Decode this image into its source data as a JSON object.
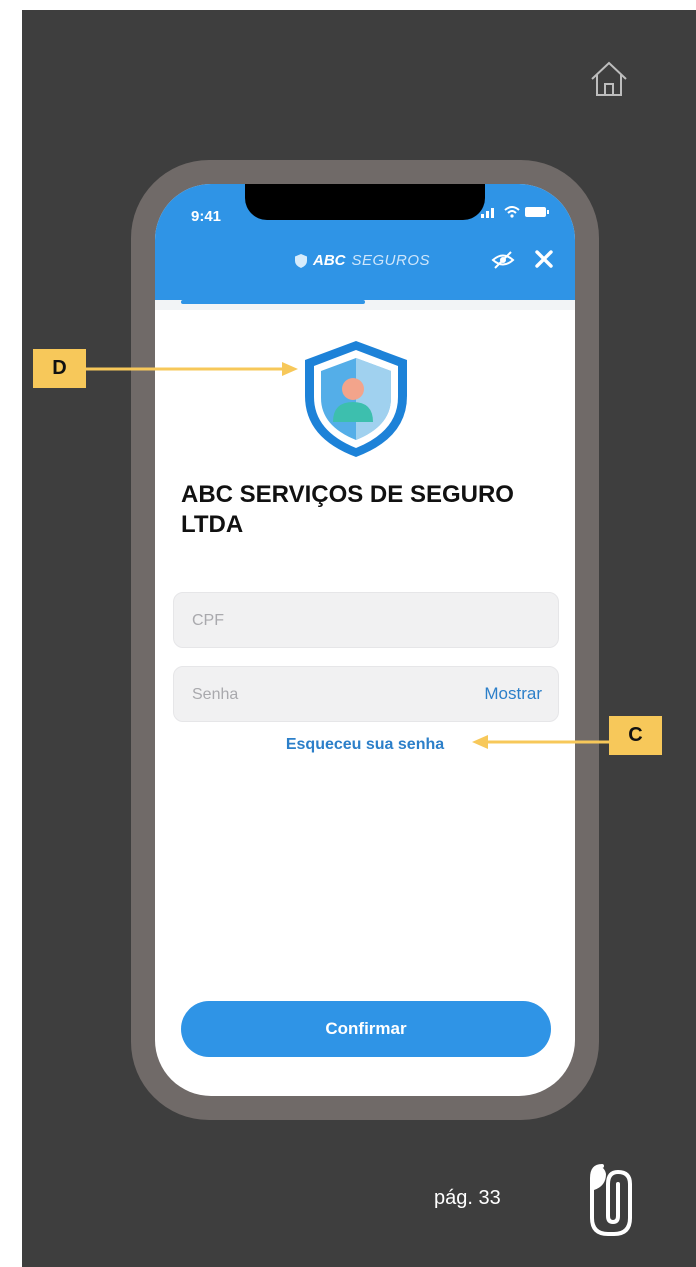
{
  "status_bar": {
    "time": "9:41"
  },
  "header": {
    "brand_bold": "ABC",
    "brand_light": "SEGUROS"
  },
  "progress": {
    "step_fraction": 0.5
  },
  "company": {
    "name": "ABC SERVIÇOS DE SEGURO LTDA"
  },
  "form": {
    "cpf_placeholder": "CPF",
    "password_placeholder": "Senha",
    "show_label": "Mostrar",
    "forgot_label": "Esqueceu sua senha",
    "confirm_label": "Confirmar"
  },
  "annotations": {
    "marker_d": "D",
    "marker_c": "C",
    "marker_color": "#f7c85a"
  },
  "footer": {
    "page_label": "pág. 33"
  },
  "colors": {
    "brand_blue": "#2f94e6",
    "link_blue": "#2c7fc9",
    "background": "#3e3e3e"
  },
  "icons": [
    "home-icon",
    "shield-icon",
    "eye-off-icon",
    "close-icon",
    "paperclip-icon"
  ]
}
